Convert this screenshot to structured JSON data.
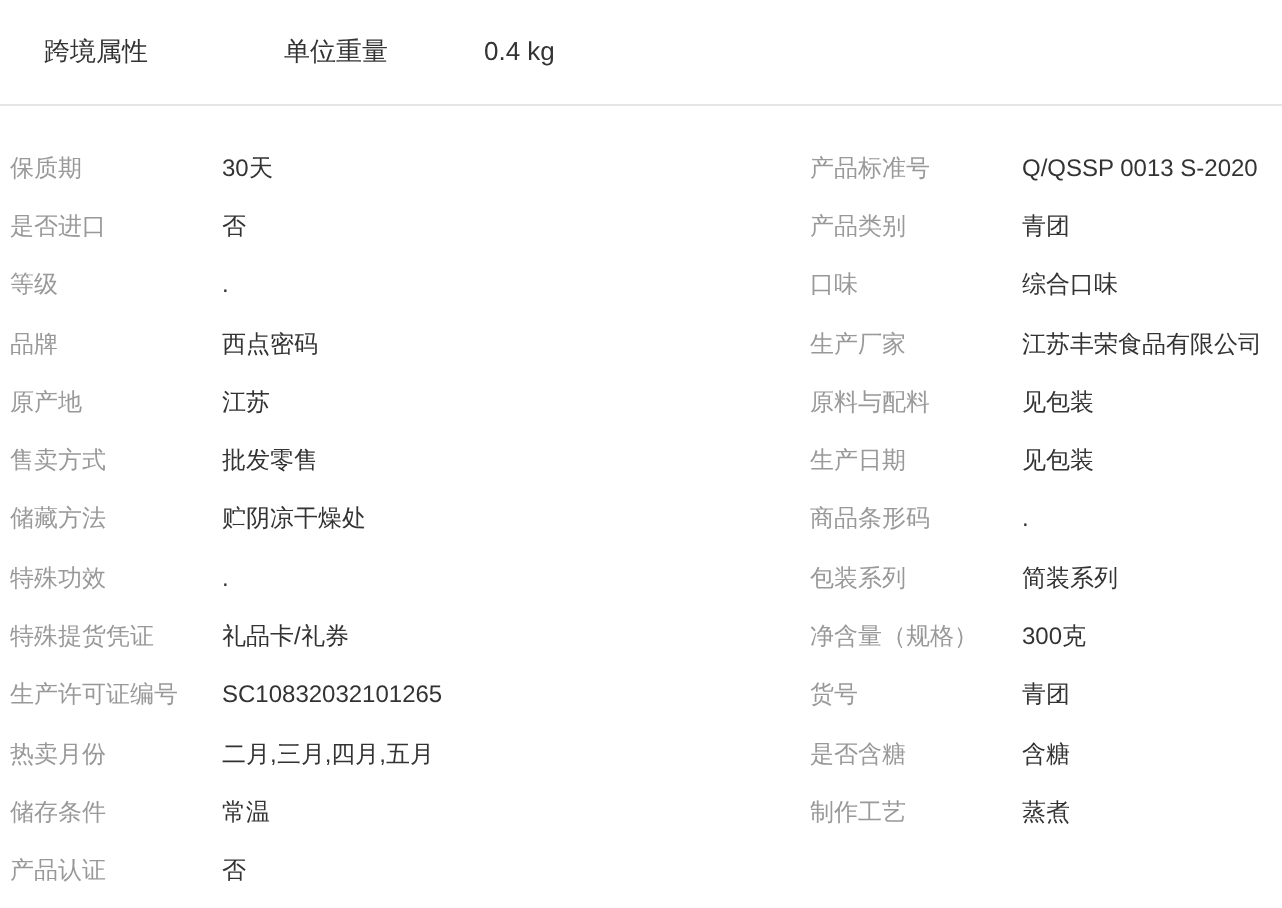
{
  "cross_border": {
    "title": "跨境属性",
    "label": "单位重量",
    "value": "0.4 kg"
  },
  "attributes": [
    {
      "label": "保质期",
      "value": "30天"
    },
    {
      "label": "产品标准号",
      "value": "Q/QSSP 0013 S-2020"
    },
    {
      "label": "是否进口",
      "value": "否"
    },
    {
      "label": "产品类别",
      "value": "青团"
    },
    {
      "label": "等级",
      "value": "."
    },
    {
      "label": "口味",
      "value": "综合口味"
    },
    {
      "label": "品牌",
      "value": "西点密码"
    },
    {
      "label": "生产厂家",
      "value": "江苏丰荣食品有限公司"
    },
    {
      "label": "原产地",
      "value": "江苏"
    },
    {
      "label": "原料与配料",
      "value": "见包装"
    },
    {
      "label": "售卖方式",
      "value": "批发零售"
    },
    {
      "label": "生产日期",
      "value": "见包装"
    },
    {
      "label": "储藏方法",
      "value": "贮阴凉干燥处"
    },
    {
      "label": "商品条形码",
      "value": "."
    },
    {
      "label": "特殊功效",
      "value": "."
    },
    {
      "label": "包装系列",
      "value": "简装系列"
    },
    {
      "label": "特殊提货凭证",
      "value": "礼品卡/礼券"
    },
    {
      "label": "净含量（规格）",
      "value": "300克"
    },
    {
      "label": "生产许可证编号",
      "value": "SC10832032101265"
    },
    {
      "label": "货号",
      "value": "青团"
    },
    {
      "label": "热卖月份",
      "value": "二月,三月,四月,五月"
    },
    {
      "label": "是否含糖",
      "value": "含糖"
    },
    {
      "label": "储存条件",
      "value": "常温"
    },
    {
      "label": "制作工艺",
      "value": "蒸煮"
    },
    {
      "label": "产品认证",
      "value": "否"
    }
  ]
}
